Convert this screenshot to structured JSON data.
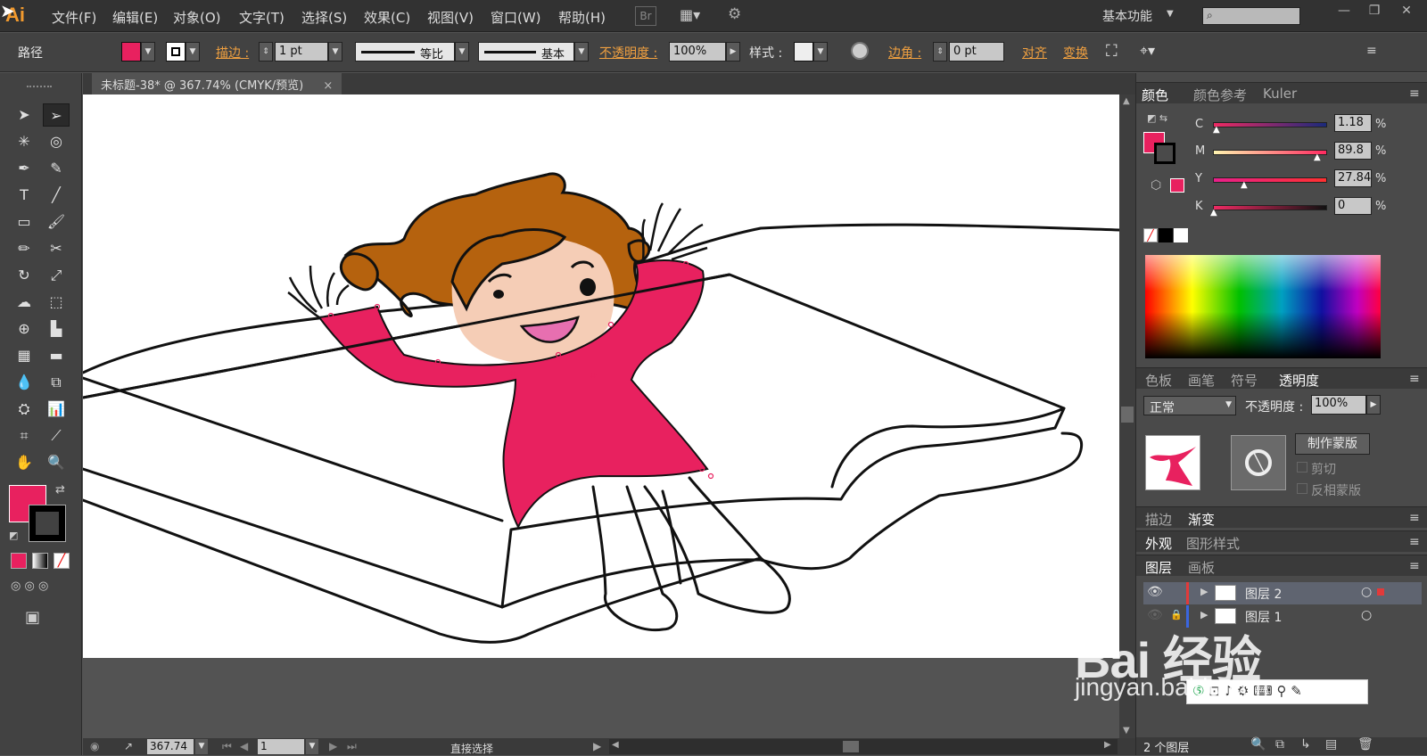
{
  "app": {
    "logo": "Ai",
    "workspace": "基本功能"
  },
  "menu": [
    "文件(F)",
    "编辑(E)",
    "对象(O)",
    "文字(T)",
    "选择(S)",
    "效果(C)",
    "视图(V)",
    "窗口(W)",
    "帮助(H)"
  ],
  "menu_extra": {
    "br": "Br"
  },
  "control": {
    "selection_type": "路径",
    "stroke_label": "描边 :",
    "stroke_weight": "1 pt",
    "profile": "等比",
    "brush": "基本",
    "opacity_label": "不透明度 :",
    "opacity": "100%",
    "style_label": "样式 :",
    "corner_label": "边角 :",
    "corner_value": "0 pt",
    "align_label": "对齐",
    "transform_label": "变换",
    "fill_color": "#e8215f"
  },
  "document": {
    "tab_title": "未标题-38* @ 367.74% (CMYK/预览)",
    "close": "×"
  },
  "status": {
    "zoom": "367.74",
    "artboard": "1",
    "tool": "直接选择"
  },
  "color_panel": {
    "tabs": [
      "颜色",
      "颜色参考",
      "Kuler"
    ],
    "channels": [
      {
        "label": "C",
        "value": "1.18",
        "percent": "%",
        "level": 0.0118
      },
      {
        "label": "M",
        "value": "89.8",
        "percent": "%",
        "level": 0.898
      },
      {
        "label": "Y",
        "value": "27.84",
        "percent": "%",
        "level": 0.2784
      },
      {
        "label": "K",
        "value": "0",
        "percent": "%",
        "level": 0
      }
    ]
  },
  "transparency_panel": {
    "tabs": [
      "色板",
      "画笔",
      "符号",
      "透明度"
    ],
    "mode": "正常",
    "opacity_label": "不透明度 :",
    "opacity": "100%",
    "make_mask": "制作蒙版",
    "clip": "剪切",
    "invert": "反相蒙版"
  },
  "stroke_panel": {
    "tabs": [
      "描边",
      "渐变"
    ]
  },
  "appearance_panel": {
    "tabs": [
      "外观",
      "图形样式"
    ]
  },
  "layers_panel": {
    "tabs": [
      "图层",
      "画板"
    ],
    "layers": [
      {
        "name": "图层 2"
      },
      {
        "name": "图层 1"
      }
    ],
    "count": "2 个图层"
  },
  "watermark": {
    "brand": "Bai 经验",
    "url": "jingyan.baidu.com"
  },
  "colors": {
    "accent": "#e8215f",
    "hair": "#b5620e",
    "skin": "#f5cdb6"
  }
}
